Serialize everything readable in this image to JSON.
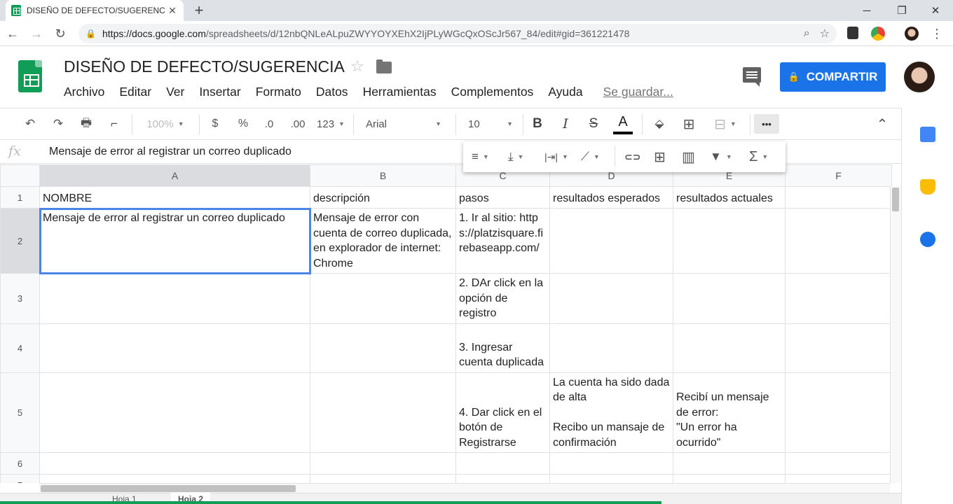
{
  "browser": {
    "tab_title": "DISEÑO DE DEFECTO/SUGERENC",
    "tab_close": "✕",
    "new_tab": "+",
    "window_controls": {
      "minimize": "─",
      "restore": "❐",
      "close": "✕"
    },
    "nav": {
      "back": "←",
      "forward": "→",
      "reload": "↻"
    },
    "url_host": "https://docs.google.com",
    "url_path": "/spreadsheets/d/12nbQNLeALpuZWYYOYXEhX2IjPLyWGcQxOScJr567_84/edit#gid=361221478",
    "menu_dots": "⋮"
  },
  "doc": {
    "title": "DISEÑO DE DEFECTO/SUGERENCIA",
    "star": "☆",
    "menu": [
      "Archivo",
      "Editar",
      "Ver",
      "Insertar",
      "Formato",
      "Datos",
      "Herramientas",
      "Complementos",
      "Ayuda"
    ],
    "saving": "Se guardar...",
    "share_label": "COMPARTIR"
  },
  "toolbar": {
    "undo": "↶",
    "redo": "↷",
    "print": "🖶",
    "paint": "⌐",
    "zoom": "100%",
    "currency": "$",
    "percent": "%",
    "dec_less": ".0",
    "dec_more": ".00",
    "more_formats": "123",
    "font": "Arial",
    "font_size": "10",
    "bold": "B",
    "italic": "I",
    "strike": "S",
    "text_color": "A",
    "fill": "⬙",
    "borders": "⊞",
    "merge": "⊟",
    "more": "•••",
    "collapse": "⌃"
  },
  "floating_toolbar": {
    "align": "≡",
    "valign": "⤓",
    "wrap": "|⇥|",
    "rotate": "⟋",
    "link": "⊂⊃",
    "comment": "⊞",
    "chart": "▥",
    "filter": "▼",
    "functions": "Σ"
  },
  "formula_bar": {
    "fx": "fx",
    "content": "Mensaje de error al registrar un correo duplicado"
  },
  "grid": {
    "columns": [
      "A",
      "B",
      "C",
      "D",
      "E",
      "F"
    ],
    "rows": [
      {
        "num": "1",
        "cells": [
          "NOMBRE",
          "descripción",
          "pasos",
          "resultados esperados",
          "resultados actuales",
          ""
        ]
      },
      {
        "num": "2",
        "cells": [
          "Mensaje de error al registrar un correo duplicado",
          "Mensaje de error con cuenta de correo duplicada, en explorador de internet: Chrome",
          "1. Ir al sitio: https://platzisquare.firebaseapp.com/",
          "",
          "",
          ""
        ]
      },
      {
        "num": "3",
        "cells": [
          "",
          "",
          "2. DAr click en la opción de registro",
          "",
          "",
          ""
        ]
      },
      {
        "num": "4",
        "cells": [
          "",
          "",
          "3. Ingresar cuenta duplicada",
          "",
          "",
          ""
        ]
      },
      {
        "num": "5",
        "cells": [
          "",
          "",
          "4. Dar click en el botón de Registrarse",
          "La cuenta ha sido dada de alta\n\nRecibo un mansaje de confirmación",
          "Recibí un mensaje de error:\n\"Un error ha ocurrido\"",
          ""
        ]
      },
      {
        "num": "6",
        "cells": [
          "",
          "",
          "",
          "",
          "",
          ""
        ]
      },
      {
        "num": "7",
        "cells": [
          "",
          "",
          "",
          "",
          "",
          ""
        ]
      }
    ]
  },
  "sheet_tabs": [
    "Hoja 1",
    "Hoja 2"
  ],
  "colors": {
    "accent": "#1a73e8",
    "sheets_green": "#0f9d58",
    "selection": "#4a86e8"
  }
}
